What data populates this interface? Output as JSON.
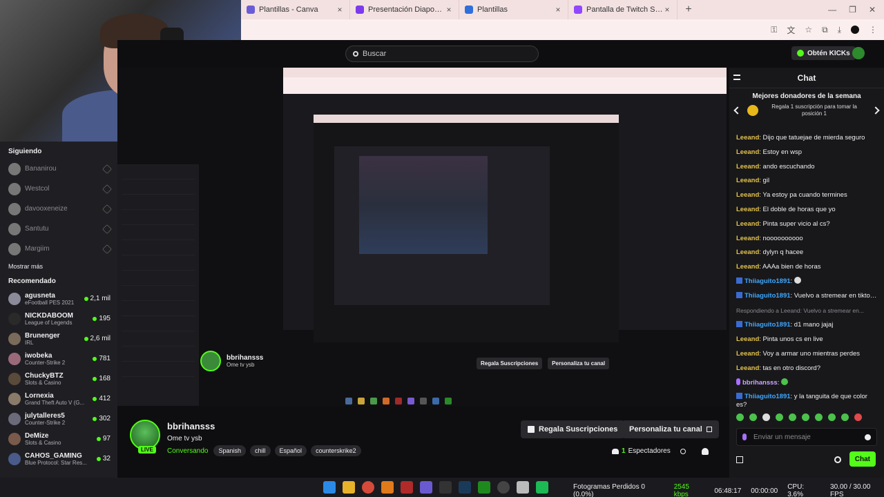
{
  "browser": {
    "tabs": [
      {
        "label": "Plantillas - Canva",
        "color": "#6b5cd6"
      },
      {
        "label": "Presentación Diapositivas Portf",
        "color": "#7c3aed"
      },
      {
        "label": "Plantillas",
        "color": "#2f6fdc"
      },
      {
        "label": "Pantalla de Twitch Streaming G",
        "color": "#9146ff"
      }
    ],
    "new_tab": "+"
  },
  "header": {
    "search_placeholder": "Buscar",
    "kicks_button": "Obtén KICKs"
  },
  "sidebar": {
    "following_title": "Siguiendo",
    "following": [
      {
        "name": "Bananirou"
      },
      {
        "name": "Westcol"
      },
      {
        "name": "davooxeneize"
      },
      {
        "name": "Santutu"
      },
      {
        "name": "Margiim"
      }
    ],
    "show_more": "Mostrar más",
    "recommended_title": "Recomendado",
    "recommended": [
      {
        "name": "agusneta",
        "game": "eFootball PES 2021",
        "viewers": "2,1 mil"
      },
      {
        "name": "NICKDABOOM",
        "game": "League of Legends",
        "viewers": "195"
      },
      {
        "name": "Brunenger",
        "game": "IRL",
        "viewers": "2,6 mil"
      },
      {
        "name": "iwobeka",
        "game": "Counter-Strike 2",
        "viewers": "781"
      },
      {
        "name": "ChuckyBTZ",
        "game": "Slots & Casino",
        "viewers": "168"
      },
      {
        "name": "Lornexia",
        "game": "Grand Theft Auto V (G...",
        "viewers": "412"
      },
      {
        "name": "julytalleres5",
        "game": "Counter-Strike 2",
        "viewers": "302"
      },
      {
        "name": "DeMize",
        "game": "Slots & Casino",
        "viewers": "97"
      },
      {
        "name": "CAHOS_GAMING",
        "game": "Blue Protocol: Star Res...",
        "viewers": "32"
      }
    ]
  },
  "stream": {
    "streamer": "bbrihansss",
    "title": "Ome tv ysb",
    "live": "LIVE",
    "category": "Conversando",
    "tags": [
      "Spanish",
      "chill",
      "Español",
      "counterskrike2"
    ],
    "gift_button": "Regala Suscripciones",
    "personalize_button": "Personaliza tu canal",
    "viewers_count": "1",
    "viewers_label": "Espectadores"
  },
  "chat": {
    "title": "Chat",
    "donors_title": "Mejores donadores de la semana",
    "donors_text": "Regala 1 suscripción para tomar la posición 1",
    "messages": [
      {
        "user": "Leeand",
        "text": "Dijo que tatuejae de mierda seguro"
      },
      {
        "user": "Leeand",
        "text": "Estoy en wsp"
      },
      {
        "user": "Leeand",
        "text": "ando escuchando"
      },
      {
        "user": "Leeand",
        "text": "gil"
      },
      {
        "user": "Leeand",
        "text": "Ya estoy pa cuando termines"
      },
      {
        "user": "Leeand",
        "text": "El doble de horas que yo"
      },
      {
        "user": "Leeand",
        "text": "Pinta super vicio al cs?"
      },
      {
        "user": "Leeand",
        "text": "noooooooooo"
      },
      {
        "user": "Leeand",
        "text": "dylyn q hacee"
      },
      {
        "user": "Leeand",
        "text": "AAAa bien de horas"
      }
    ],
    "thia_user": "Thiiaguito1891",
    "thia_msg1": "Vuelvo a stremear en tiktok? dea",
    "reply_prefix": "Respondiendo a Leeand: Vuelvo a stremear en...",
    "thia_msg2": "d1 mano jajaj",
    "leeand_user": "Leeand",
    "leeand_msg11": "Pinta unos cs en live",
    "leeand_msg12": "Voy a armar uno mientras perdes",
    "leeand_msg13": "tas en otro discord?",
    "bbri_user": "bbrihansss",
    "thia_msg3": "y la tanguita de que color es?",
    "input_placeholder": "Enviar un mensaje",
    "send_button": "Chat"
  },
  "taskbar": {
    "dropped_frames": "Fotogramas Perdidos 0 (0.0%)",
    "bitrate": "2545 kbps",
    "time": "06:48:17",
    "rec_time": "00:00:00",
    "cpu": "CPU: 3.6%",
    "fps": "30.00 / 30.00 FPS"
  }
}
